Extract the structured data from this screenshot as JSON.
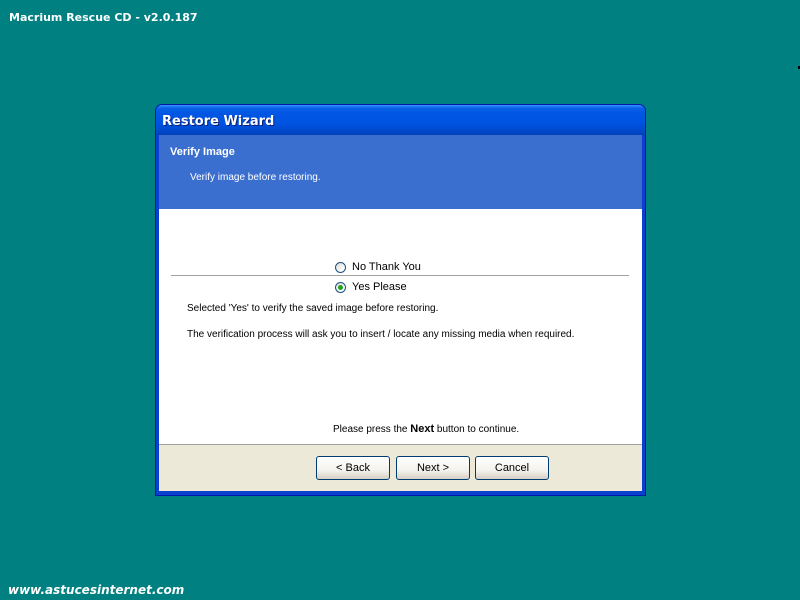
{
  "desktop": {
    "title": "Macrium Rescue CD - v2.0.187",
    "watermark": "www.astucesinternet.com"
  },
  "window": {
    "title": "Restore Wizard",
    "header": {
      "title": "Verify Image",
      "subtitle": "Verify image before restoring."
    },
    "options": [
      {
        "label": "No Thank You",
        "selected": false
      },
      {
        "label": "Yes Please",
        "selected": true
      }
    ],
    "info": {
      "line1": "Selected 'Yes' to verify the saved image before restoring.",
      "line2": "The verification process will ask you to insert / locate any missing media when required."
    },
    "continue": {
      "prefix": "Please press the",
      "bold": "Next",
      "suffix": "button to continue."
    },
    "buttons": {
      "back": "< Back",
      "next": "Next >",
      "cancel": "Cancel"
    }
  },
  "colors": {
    "desktop": "#008080",
    "titlebar": "#0054e2",
    "header_band": "#3a6fd0",
    "button_panel": "#ece9d8",
    "radio_dot": "#21a121"
  }
}
